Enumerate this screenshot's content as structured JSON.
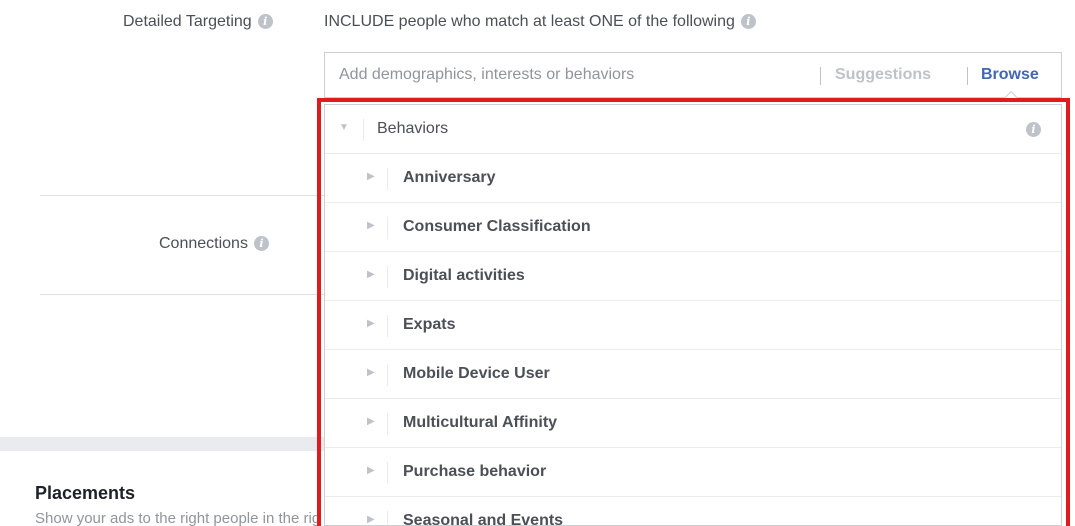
{
  "targeting": {
    "label": "Detailed Targeting",
    "include_text": "INCLUDE people who match at least ONE of the following",
    "search": {
      "placeholder": "Add demographics, interests or behaviors",
      "value": ""
    },
    "suggestions_label": "Suggestions",
    "browse_label": "Browse"
  },
  "connections": {
    "label": "Connections"
  },
  "dropdown": {
    "category": "Behaviors",
    "items": [
      {
        "label": "Anniversary"
      },
      {
        "label": "Consumer Classification"
      },
      {
        "label": "Digital activities"
      },
      {
        "label": "Expats"
      },
      {
        "label": "Mobile Device User"
      },
      {
        "label": "Multicultural Affinity"
      },
      {
        "label": "Purchase behavior"
      },
      {
        "label": "Seasonal and Events"
      }
    ]
  },
  "placements": {
    "title": "Placements",
    "description": "Show your ads to the right people in the right places."
  },
  "icons": {
    "info": "info-icon",
    "expand": "triangle-right-icon",
    "collapse": "triangle-down-icon"
  },
  "colors": {
    "accent": "#4267b2",
    "highlight": "#e01b1b",
    "text": "#4b4f56",
    "muted": "#90949c"
  }
}
